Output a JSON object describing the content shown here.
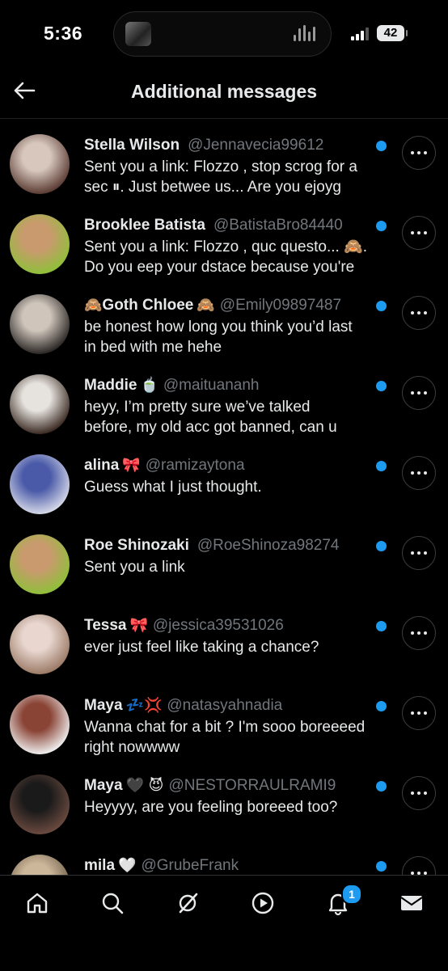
{
  "status_bar": {
    "time": "5:36",
    "battery": "42"
  },
  "header": {
    "title": "Additional messages"
  },
  "conversations": [
    {
      "name": "Stella Wilson",
      "emoji_before": "",
      "emoji_after": "",
      "handle": "@Jennavecia99612",
      "preview": "Sent you a link: Flozzo , stop scrog for a\nsec ⏸. Just betwee us... Are you ejoyg",
      "avatar_colors": [
        "#d7c7bd",
        "#5a3b33"
      ]
    },
    {
      "name": "Brooklee Batista",
      "emoji_before": "",
      "emoji_after": "",
      "handle": "@BatistaBro84440",
      "preview": "Sent you a link: Flozzo , quc questo... 🙈.\nDo you eep your dstace because you're",
      "avatar_colors": [
        "#c99a6e",
        "#8fbf3a"
      ]
    },
    {
      "name": "Goth Chloee",
      "emoji_before": "🙈",
      "emoji_after": "🙈",
      "handle": "@Emily09897487",
      "preview": "be honest how long you think you’d last\nin bed with me hehe",
      "avatar_colors": [
        "#cfc5bb",
        "#2a2624"
      ]
    },
    {
      "name": "Maddie",
      "emoji_before": "",
      "emoji_after": "🍵",
      "handle": "@maituananh",
      "preview": "heyy, I’m pretty sure we’ve talked\nbefore, my old acc got banned, can u",
      "avatar_colors": [
        "#e6e2de",
        "#3a2a22"
      ]
    },
    {
      "name": "alina",
      "emoji_before": "",
      "emoji_after": "🎀",
      "handle": "@ramizaytona",
      "preview": "Guess what I just thought.",
      "avatar_colors": [
        "#4a5aa8",
        "#d6d9e8"
      ]
    },
    {
      "name": "Roe Shinozaki",
      "emoji_before": "",
      "emoji_after": "",
      "handle": "@RoeShinoza98274",
      "preview": "Sent you a link",
      "avatar_colors": [
        "#c99a6e",
        "#8fbf3a"
      ]
    },
    {
      "name": "Tessa",
      "emoji_before": "",
      "emoji_after": "🎀",
      "handle": "@jessica39531026",
      "preview": "ever just feel like taking a chance?",
      "avatar_colors": [
        "#e8d6cf",
        "#9b7a66"
      ]
    },
    {
      "name": "Maya",
      "emoji_before": "",
      "emoji_after": "💤💢",
      "handle": "@natasyahnadia",
      "preview": "Wanna chat for a bit ? I'm sooo boreeeed\nright nowwww",
      "avatar_colors": [
        "#8a4436",
        "#efefef"
      ]
    },
    {
      "name": "Maya",
      "emoji_before": "",
      "emoji_after": "🖤 😈",
      "handle": "@NESTORRAULRAMI9",
      "preview": "Heyyyy, are you feeling boreeed too?",
      "avatar_colors": [
        "#1a1a1a",
        "#6b4a3f"
      ]
    },
    {
      "name": "mila",
      "emoji_before": "",
      "emoji_after": "🤍",
      "handle": "@GrubeFrank",
      "preview": "",
      "avatar_colors": [
        "#cdb79a",
        "#6a5a48"
      ]
    }
  ],
  "tabbar": {
    "items": [
      "home-icon",
      "search-icon",
      "grok-icon",
      "video-icon",
      "bell-icon",
      "mail-icon"
    ],
    "notification_count": "1"
  },
  "colors": {
    "accent": "#1d9bf0",
    "text": "#e7e9ea",
    "muted": "#71767b",
    "background": "#000000"
  }
}
